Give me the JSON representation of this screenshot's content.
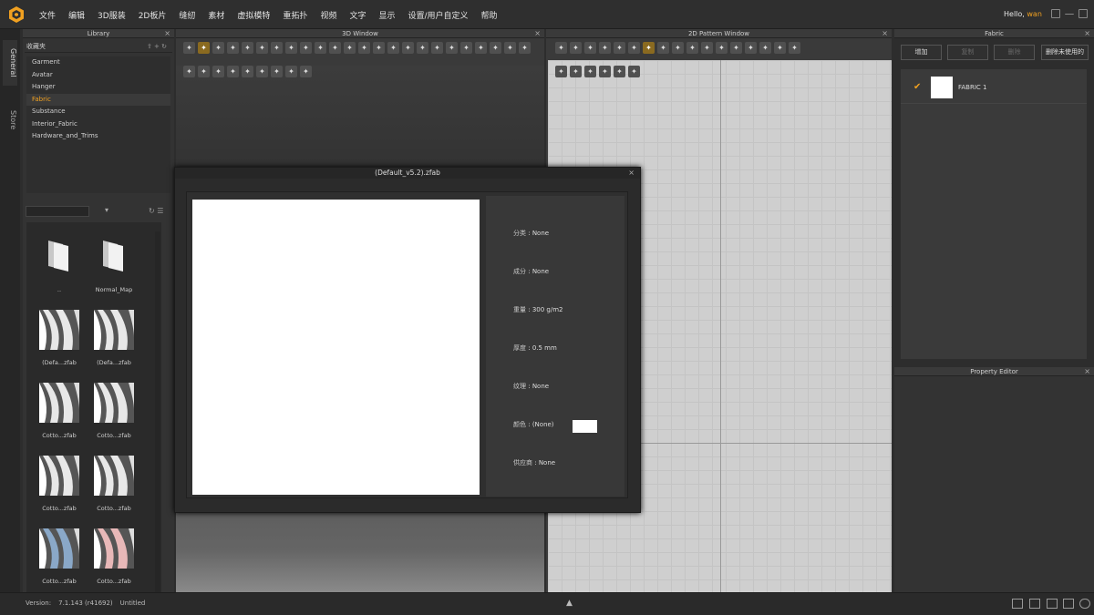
{
  "menubar": {
    "items": [
      "文件",
      "编辑",
      "3D服装",
      "2D板片",
      "缝纫",
      "素材",
      "虚拟模特",
      "重拓扑",
      "视频",
      "文字",
      "显示",
      "设置/用户自定义",
      "帮助"
    ],
    "hello": "Hello,",
    "user": "wan"
  },
  "sidetabs": [
    "General",
    "Store"
  ],
  "library": {
    "title": "Library",
    "favorites": "收藏夹",
    "tree": [
      "Garment",
      "Avatar",
      "Hanger",
      "Fabric",
      "Substance",
      "Interior_Fabric",
      "Hardware_and_Trims"
    ],
    "selected": "Fabric",
    "grid": [
      {
        "label": "..",
        "kind": "folder"
      },
      {
        "label": "Normal_Map",
        "kind": "folder"
      },
      {
        "label": "(Defa...zfab",
        "kind": "fabric",
        "color": "#e8e8e8"
      },
      {
        "label": "(Defa...zfab",
        "kind": "fabric",
        "color": "#e8e8e8"
      },
      {
        "label": "Cotto...zfab",
        "kind": "fabric",
        "color": "#e8e8e8"
      },
      {
        "label": "Cotto...zfab",
        "kind": "fabric",
        "color": "#e8e8e8"
      },
      {
        "label": "Cotto...zfab",
        "kind": "fabric",
        "color": "#e8e8e8"
      },
      {
        "label": "Cotto...zfab",
        "kind": "fabric",
        "color": "#e8e8e8"
      },
      {
        "label": "Cotto...zfab",
        "kind": "fabric",
        "color": "#8aa8c8"
      },
      {
        "label": "Cotto...zfab",
        "kind": "fabric",
        "color": "#e8b8b8"
      }
    ]
  },
  "window3d": {
    "title": "3D Window"
  },
  "window2d": {
    "title": "2D Pattern Window"
  },
  "fabricPanel": {
    "title": "Fabric",
    "buttons": {
      "add": "增加",
      "copy": "复制",
      "delete": "删除",
      "delete_unused": "删除未使用的"
    },
    "item": "FABRIC 1"
  },
  "propertyEditor": {
    "title": "Property Editor"
  },
  "status": {
    "version_label": "Version:",
    "version": "7.1.143 (r41692)",
    "file": "Untitled"
  },
  "dialog": {
    "title": "(Default_v5.2).zfab",
    "props": [
      {
        "key": "分类",
        "value": "None"
      },
      {
        "key": "成分",
        "value": "None"
      },
      {
        "key": "重量",
        "value": "300 g/m2"
      },
      {
        "key": "厚度",
        "value": "0.5 mm"
      },
      {
        "key": "纹理",
        "value": "None"
      },
      {
        "key": "颜色",
        "value": "(None)"
      },
      {
        "key": "供应商",
        "value": "None"
      }
    ],
    "swatch_color": "#ffffff"
  },
  "colors": {
    "accent": "#f0a020"
  }
}
